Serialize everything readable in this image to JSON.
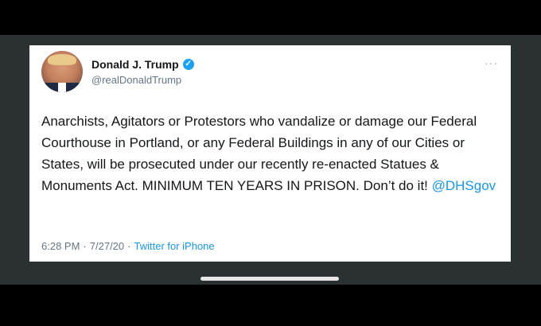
{
  "tweet": {
    "display_name": "Donald J. Trump",
    "verified_glyph": "✓",
    "handle": "@realDonaldTrump",
    "more_glyph": "···",
    "text": "Anarchists, Agitators or Protestors who vandalize or damage our Federal Courthouse in Portland, or any Federal Buildings in any of our Cities or States, will be prosecuted under our recently re-enacted Statues & Monuments Act. MINIMUM TEN YEARS IN PRISON. Don’t do it! ",
    "mention": "@DHSgov",
    "time": "6:28 PM",
    "separator": "·",
    "date": "7/27/20",
    "separator2": "·",
    "source": "Twitter for iPhone"
  },
  "colors": {
    "link": "#1b95e0",
    "verified": "#1da1f2",
    "background": "#2b3033"
  },
  "icons": {
    "verified": "verified-badge-icon",
    "more": "more-options-icon"
  }
}
